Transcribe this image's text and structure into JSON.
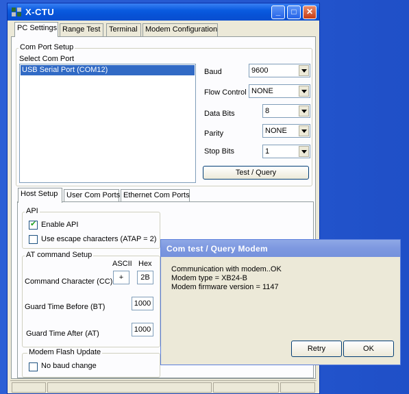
{
  "window": {
    "title": "X-CTU",
    "controls": {
      "minimize": "_",
      "maximize": "□",
      "close": "✕"
    }
  },
  "main_tabs": [
    "PC Settings",
    "Range Test",
    "Terminal",
    "Modem Configuration"
  ],
  "com_port_setup": {
    "group_label": "Com Port Setup",
    "select_label": "Select Com Port",
    "ports": [
      "USB Serial Port (COM12)"
    ],
    "baud": {
      "label": "Baud",
      "value": "9600"
    },
    "flow_control": {
      "label": "Flow Control",
      "value": "NONE"
    },
    "data_bits": {
      "label": "Data Bits",
      "value": "8"
    },
    "parity": {
      "label": "Parity",
      "value": "NONE"
    },
    "stop_bits": {
      "label": "Stop Bits",
      "value": "1"
    },
    "test_button": "Test  / Query"
  },
  "sub_tabs": [
    "Host Setup",
    "User Com Ports",
    "Ethernet Com Ports"
  ],
  "api": {
    "group_label": "API",
    "enable_api": {
      "label": "Enable API",
      "checked": true
    },
    "escape_chars": {
      "label": "Use escape characters (ATAP = 2)",
      "checked": false
    }
  },
  "at_command": {
    "group_label": "AT command Setup",
    "ascii_header": "ASCII",
    "hex_header": "Hex",
    "command_char": {
      "label": "Command Character (CC)",
      "ascii": "+",
      "hex": "2B"
    },
    "guard_before": {
      "label": "Guard Time Before (BT)",
      "value": "1000"
    },
    "guard_after": {
      "label": "Guard Time After (AT)",
      "value": "1000"
    }
  },
  "flash_update": {
    "group_label": "Modem Flash Update",
    "no_baud_change": {
      "label": "No baud change",
      "checked": false
    }
  },
  "dialog": {
    "title": "Com test / Query Modem",
    "lines": [
      "Communication with modem..OK",
      "Modem type = XB24-B",
      "Modem firmware version = 1147"
    ],
    "retry_button": "Retry",
    "ok_button": "OK"
  }
}
